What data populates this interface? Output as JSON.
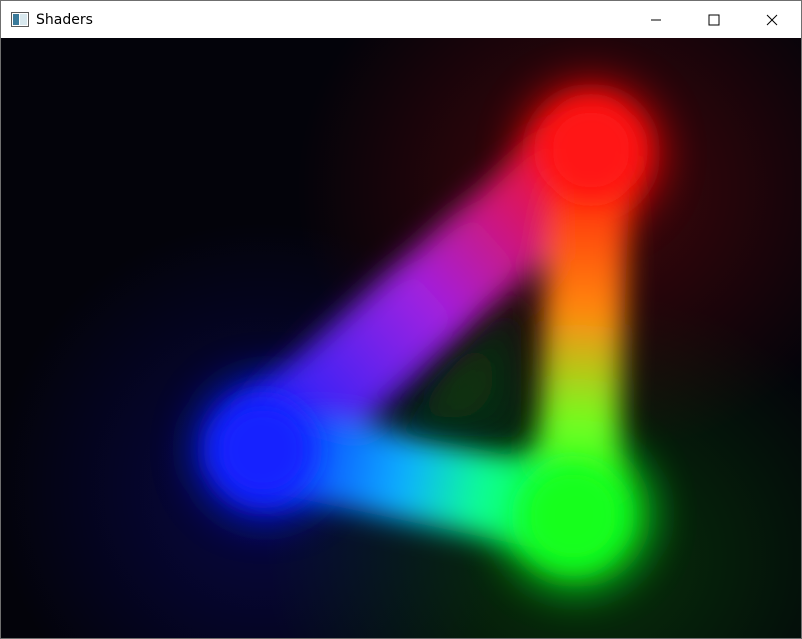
{
  "window": {
    "title": "Shaders",
    "icon": "app-window-icon",
    "controls": {
      "minimize_icon": "minimize-icon",
      "maximize_icon": "maximize-icon",
      "close_icon": "close-icon"
    }
  },
  "shader": {
    "vertex_colors": {
      "top": "#ff1010",
      "bottom_right": "#10ff20",
      "left": "#1020ff"
    }
  }
}
